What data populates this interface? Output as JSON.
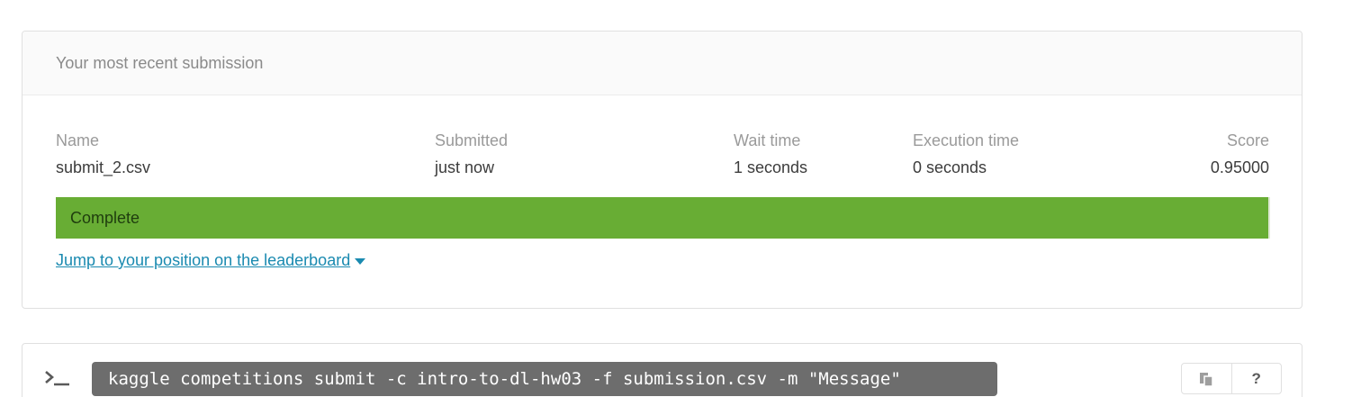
{
  "submission": {
    "header": "Your most recent submission",
    "columns": {
      "name": {
        "label": "Name",
        "value": "submit_2.csv"
      },
      "submitted": {
        "label": "Submitted",
        "value": "just now"
      },
      "wait_time": {
        "label": "Wait time",
        "value": "1 seconds"
      },
      "execution_time": {
        "label": "Execution time",
        "value": "0 seconds"
      },
      "score": {
        "label": "Score",
        "value": "0.95000"
      }
    },
    "status": "Complete",
    "status_color": "#68ad34",
    "jump_link": "Jump to your position on the leaderboard",
    "link_color": "#1a8ab0"
  },
  "cli": {
    "prompt_icon": "terminal-prompt-icon",
    "command": "kaggle competitions submit -c intro-to-dl-hw03 -f submission.csv -m \"Message\"",
    "copy_icon": "copy-icon",
    "help_label": "?"
  }
}
